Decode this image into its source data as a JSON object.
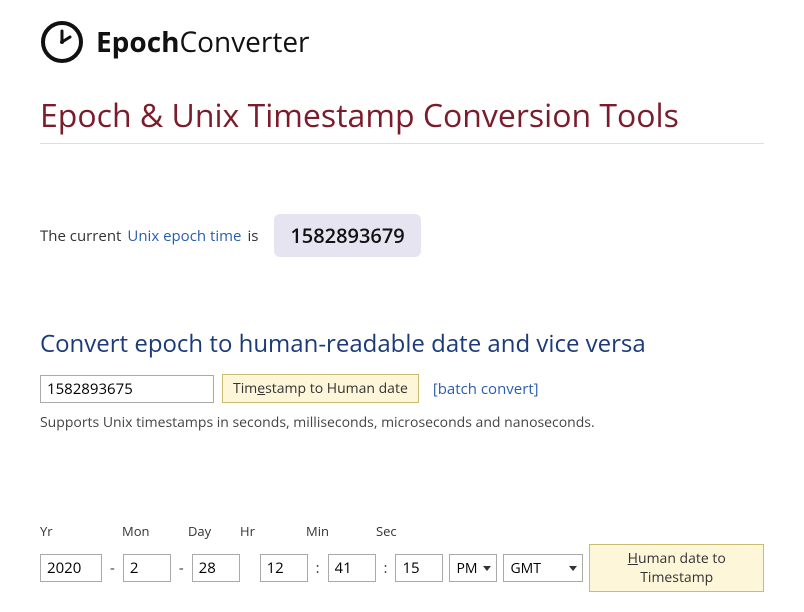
{
  "logo": {
    "bold": "Epoch",
    "rest": "Converter"
  },
  "page_title": "Epoch & Unix Timestamp Conversion Tools",
  "current": {
    "prefix": "The current ",
    "link": "Unix epoch time",
    "suffix": " is",
    "value": "1582893679"
  },
  "section1": {
    "title": "Convert epoch to human-readable date and vice versa",
    "input_value": "1582893675",
    "button_prefix": "Tim",
    "button_ul": "e",
    "button_suffix": "stamp to Human date",
    "batch_link": "[batch convert]",
    "hint": "Supports Unix timestamps in seconds, milliseconds, microseconds and nanoseconds."
  },
  "datetime": {
    "labels": {
      "yr": "Yr",
      "mon": "Mon",
      "day": "Day",
      "hr": "Hr",
      "min": "Min",
      "sec": "Sec"
    },
    "values": {
      "yr": "2020",
      "mon": "2",
      "day": "28",
      "hr": "12",
      "min": "41",
      "sec": "15"
    },
    "ampm": "PM",
    "tz": "GMT",
    "button_ul": "H",
    "button_suffix": "uman date to Timestamp"
  }
}
